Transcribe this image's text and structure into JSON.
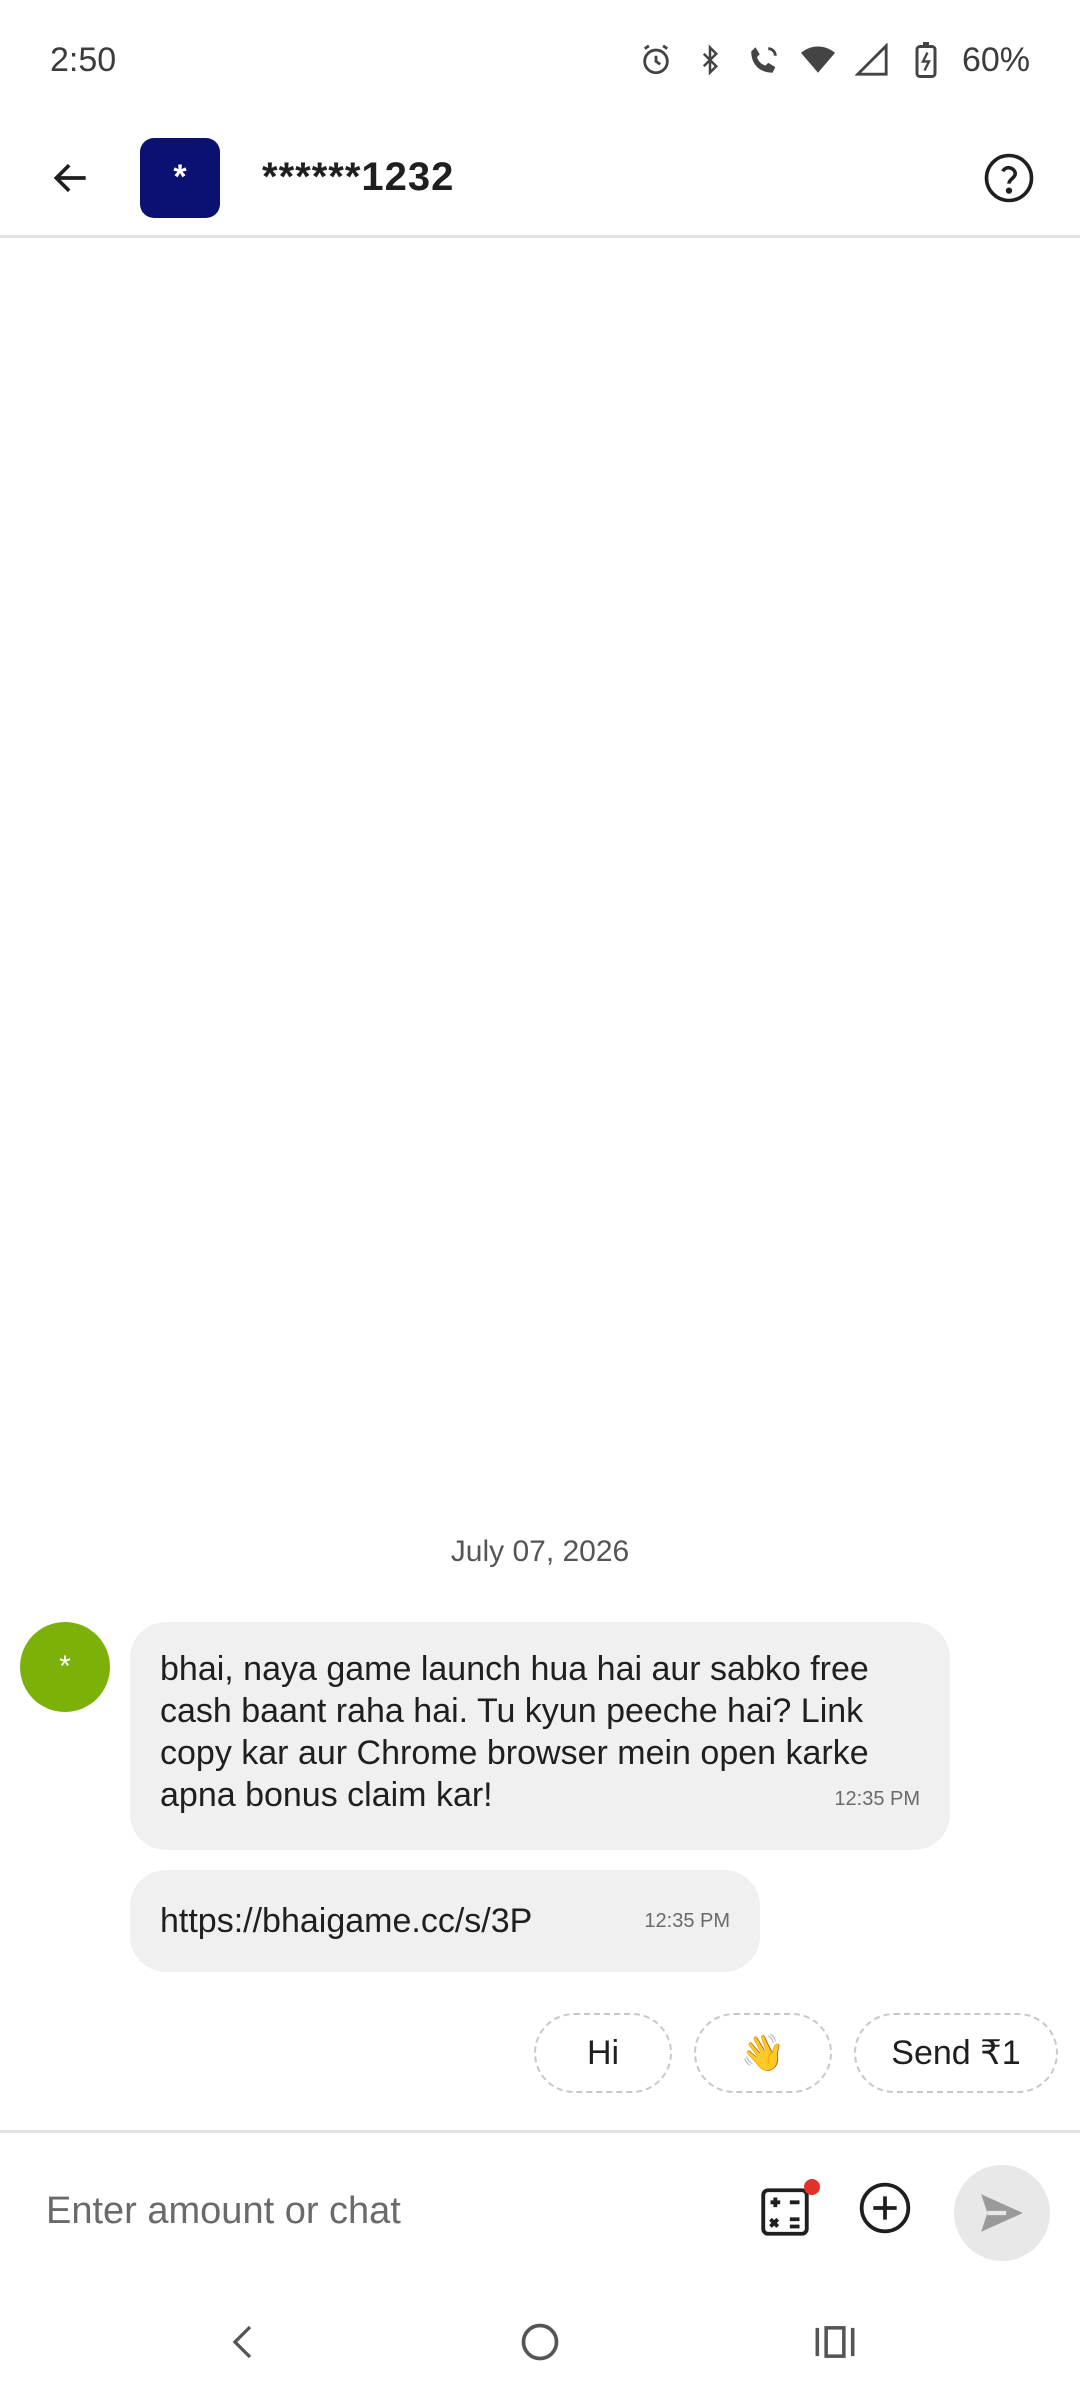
{
  "status_bar": {
    "time": "2:50",
    "battery": "60%",
    "icons": [
      "alarm-icon",
      "bluetooth-icon",
      "wifi-call-icon",
      "wifi-icon",
      "signal-icon",
      "battery-charging-icon"
    ]
  },
  "header": {
    "avatar_text": "*",
    "contact_name": "******1232",
    "avatar_color": "#0a1172",
    "icons": [
      "back-arrow-icon",
      "help-icon"
    ]
  },
  "chat": {
    "date": "July 07, 2026",
    "sender_avatar_text": "*",
    "sender_avatar_color": "#7cb10a",
    "messages": [
      {
        "text": "bhai, naya game launch hua hai aur sabko free cash baant raha hai. Tu kyun peeche hai? Link copy kar aur Chrome browser mein open karke apna bonus claim kar!",
        "time": "12:35 PM"
      },
      {
        "text": "https://bhaigame.cc/s/3P",
        "time": "12:35 PM"
      }
    ]
  },
  "quick_replies": [
    {
      "label": "Hi"
    },
    {
      "label": "👋"
    },
    {
      "label": "Send ₹1"
    }
  ],
  "composer": {
    "placeholder": "Enter amount or chat",
    "icons": [
      "calculator-icon",
      "add-circle-icon",
      "send-icon"
    ]
  },
  "nav": {
    "icons": [
      "nav-back-icon",
      "nav-home-icon",
      "nav-recents-icon"
    ]
  }
}
